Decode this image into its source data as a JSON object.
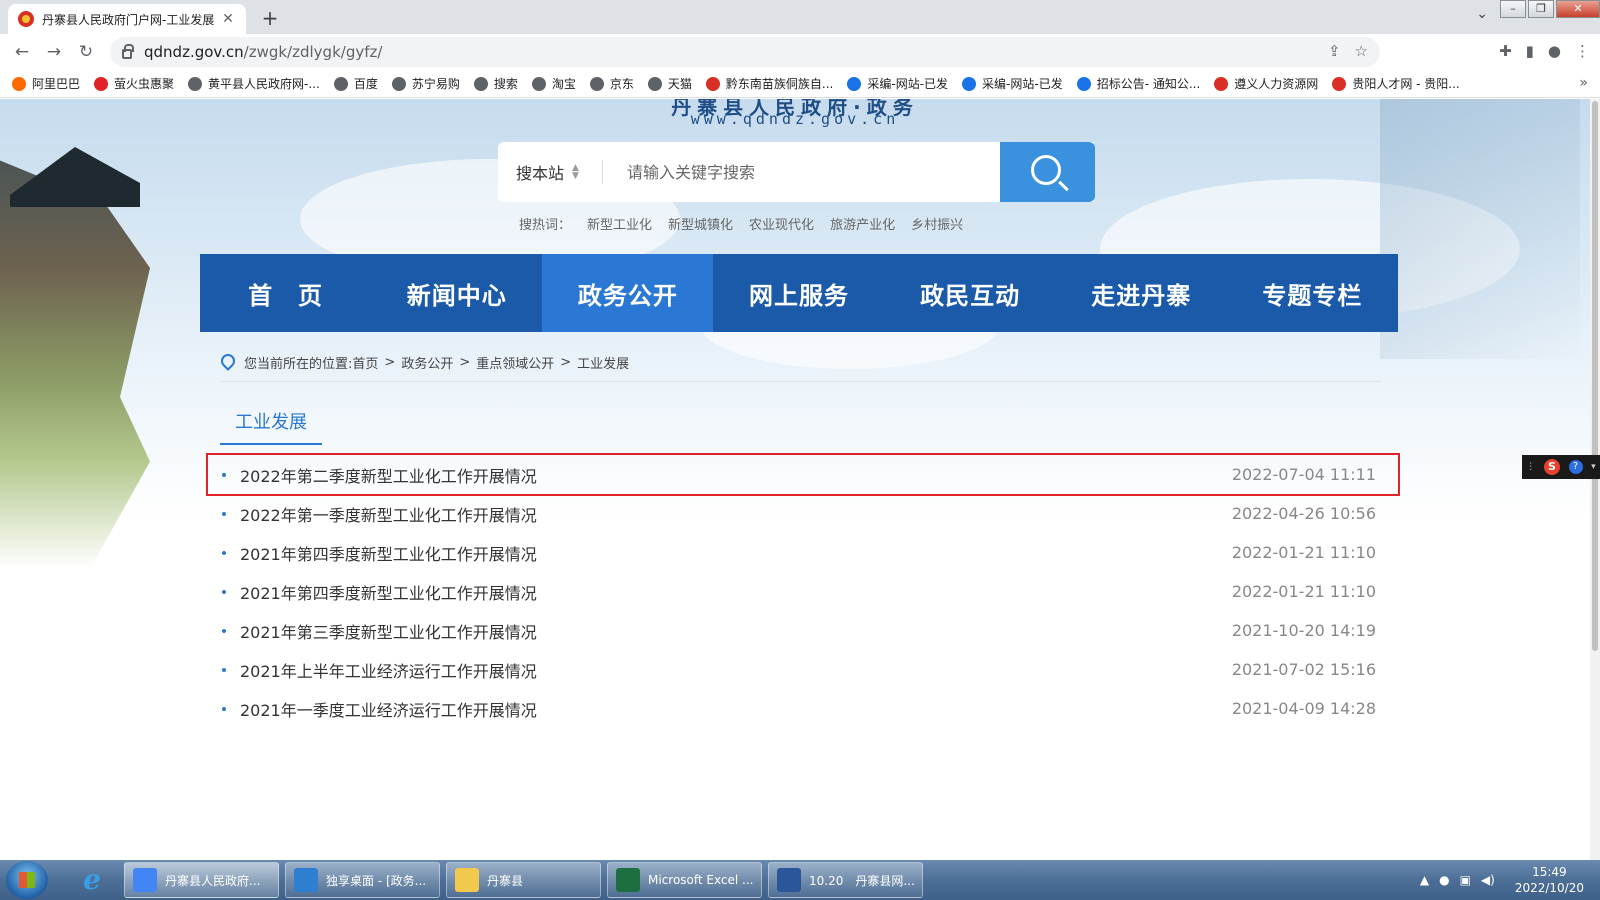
{
  "browser": {
    "tab_title": "丹寨县人民政府门户网-工业发展",
    "tab_close": "✕",
    "new_tab": "+",
    "url_host": "qdndz.gov.cn",
    "url_path": "/zwgk/zdlygk/gyfz/",
    "bookmarks": [
      {
        "label": "阿里巴巴",
        "color": "#ff6a00"
      },
      {
        "label": "萤火虫惠聚",
        "color": "#e0232b"
      },
      {
        "label": "黄平县人民政府网-...",
        "color": "#5f6368"
      },
      {
        "label": "百度",
        "color": "#5f6368"
      },
      {
        "label": "苏宁易购",
        "color": "#5f6368"
      },
      {
        "label": "搜索",
        "color": "#5f6368"
      },
      {
        "label": "淘宝",
        "color": "#5f6368"
      },
      {
        "label": "京东",
        "color": "#5f6368"
      },
      {
        "label": "天猫",
        "color": "#5f6368"
      },
      {
        "label": "黔东南苗族侗族自...",
        "color": "#d93025"
      },
      {
        "label": "采编-网站-已发",
        "color": "#1a73e8"
      },
      {
        "label": "采编-网站-已发",
        "color": "#1a73e8"
      },
      {
        "label": "招标公告- 通知公...",
        "color": "#1a73e8"
      },
      {
        "label": "遵义人力资源网",
        "color": "#d93025"
      },
      {
        "label": "贵阳人才网 - 贵阳...",
        "color": "#d93025"
      }
    ],
    "bookmarks_more": "»"
  },
  "site": {
    "title": "丹寨县人民政府·政务",
    "url": "www.qdndz.gov.cn",
    "search": {
      "scope": "搜本站",
      "placeholder": "请输入关键字搜索"
    },
    "hotwords_label": "搜热词：",
    "hotwords": [
      "新型工业化",
      "新型城镇化",
      "农业现代化",
      "旅游产业化",
      "乡村振兴"
    ],
    "nav": [
      {
        "label": "首　页",
        "active": false
      },
      {
        "label": "新闻中心",
        "active": false
      },
      {
        "label": "政务公开",
        "active": true
      },
      {
        "label": "网上服务",
        "active": false
      },
      {
        "label": "政民互动",
        "active": false
      },
      {
        "label": "走进丹寨",
        "active": false
      },
      {
        "label": "专题专栏",
        "active": false
      }
    ],
    "breadcrumb": {
      "prefix": "您当前所在的位置:",
      "items": [
        "首页",
        "政务公开",
        "重点领域公开",
        "工业发展"
      ],
      "separator": ">"
    },
    "section_tab": "工业发展",
    "news": [
      {
        "title": "2022年第二季度新型工业化工作开展情况",
        "date": "2022-07-04 11:11",
        "highlight": true
      },
      {
        "title": "2022年第一季度新型工业化工作开展情况",
        "date": "2022-04-26 10:56",
        "highlight": false
      },
      {
        "title": "2021年第四季度新型工业化工作开展情况",
        "date": "2022-01-21 11:10",
        "highlight": false
      },
      {
        "title": "2021年第四季度新型工业化工作开展情况",
        "date": "2022-01-21 11:10",
        "highlight": false
      },
      {
        "title": "2021年第三季度新型工业化工作开展情况",
        "date": "2021-10-20 14:19",
        "highlight": false
      },
      {
        "title": "2021年上半年工业经济运行工作开展情况",
        "date": "2021-07-02 15:16",
        "highlight": false
      },
      {
        "title": "2021年一季度工业经济运行工作开展情况",
        "date": "2021-04-09 14:28",
        "highlight": false
      }
    ]
  },
  "ime": {
    "s": "S",
    "q": "?"
  },
  "taskbar": {
    "ie_glyph": "e",
    "tasks": [
      {
        "label": "丹寨县人民政府...",
        "color": "#4285f4",
        "active": true
      },
      {
        "label": "独享桌面 - [政务...",
        "color": "#2f7fd1",
        "active": false
      },
      {
        "label": "丹寨县",
        "color": "#f2c94c",
        "active": false
      },
      {
        "label": "Microsoft Excel ...",
        "color": "#1d6f42",
        "active": false
      },
      {
        "label": "10.20　丹寨县网...",
        "color": "#2b579a",
        "active": false
      }
    ],
    "time": "15:49",
    "date": "2022/10/20"
  }
}
